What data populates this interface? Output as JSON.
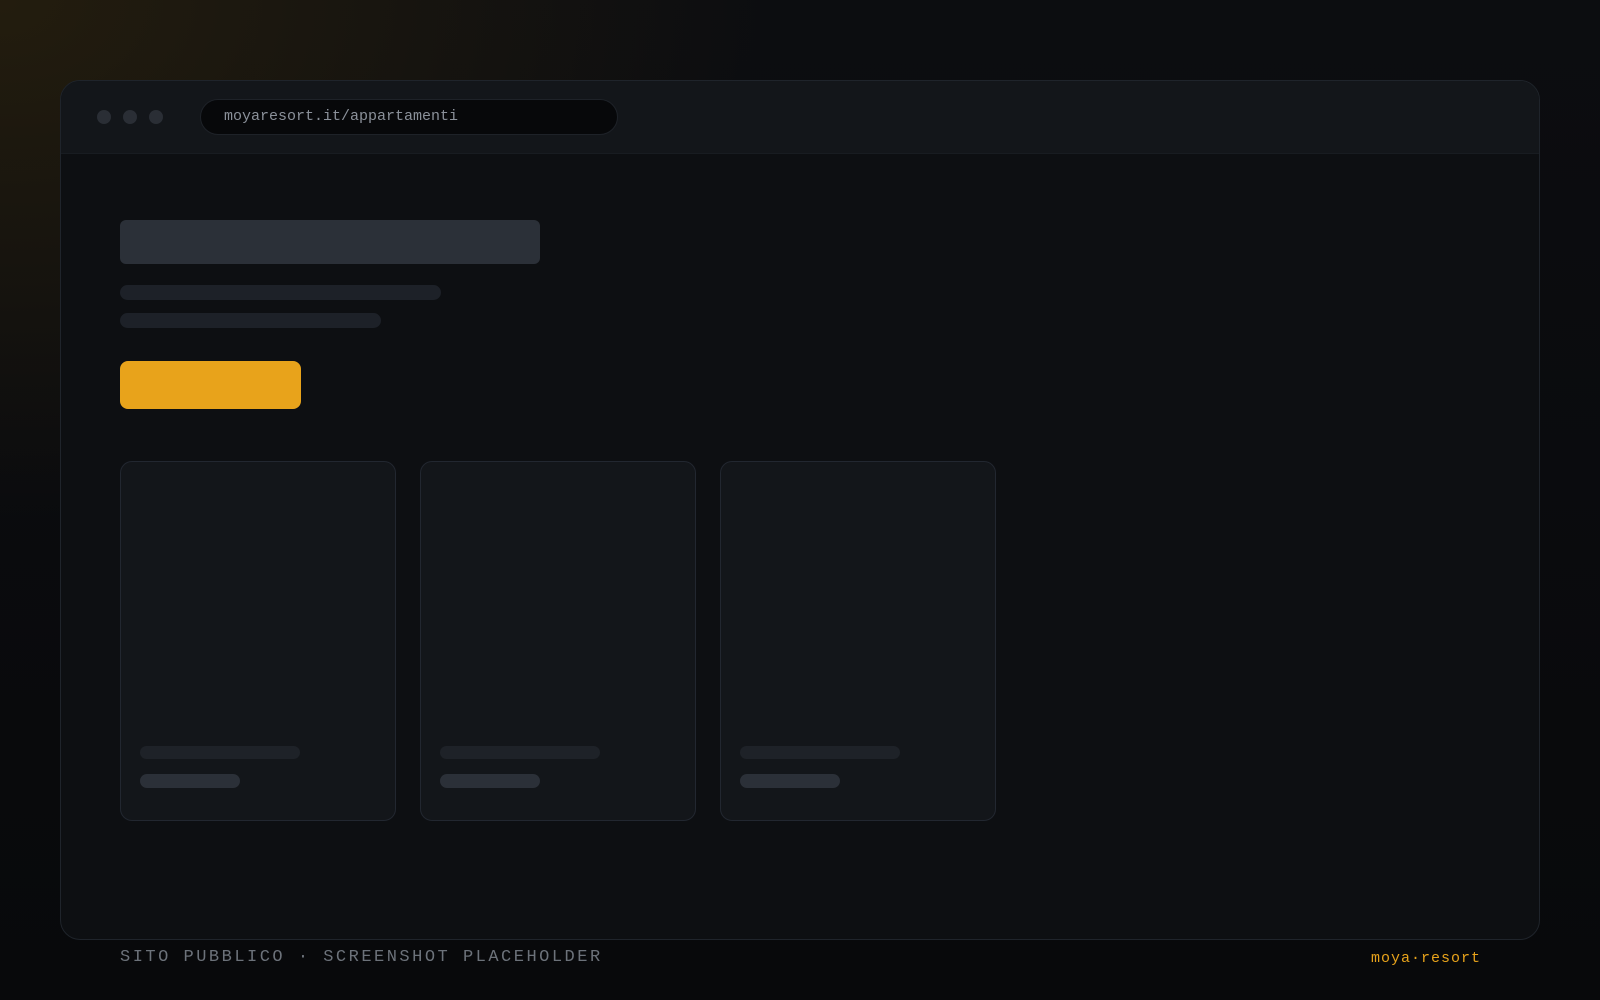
{
  "browser": {
    "url": "moyaresort.it/appartamenti",
    "window_controls": [
      "close-dot-icon",
      "minimize-dot-icon",
      "maximize-dot-icon"
    ]
  },
  "page": {
    "cards": [
      {
        "id": "card-1"
      },
      {
        "id": "card-2"
      },
      {
        "id": "card-3"
      }
    ]
  },
  "footer": {
    "caption": "SITO PUBBLICO · SCREENSHOT PLACEHOLDER",
    "brand": "moya·resort"
  },
  "colors": {
    "accent": "#e8a31b",
    "background": "#0d0f12",
    "titlebar": "#13161a",
    "skeleton": "#2b3038",
    "skeleton_dim": "#1d2128"
  }
}
